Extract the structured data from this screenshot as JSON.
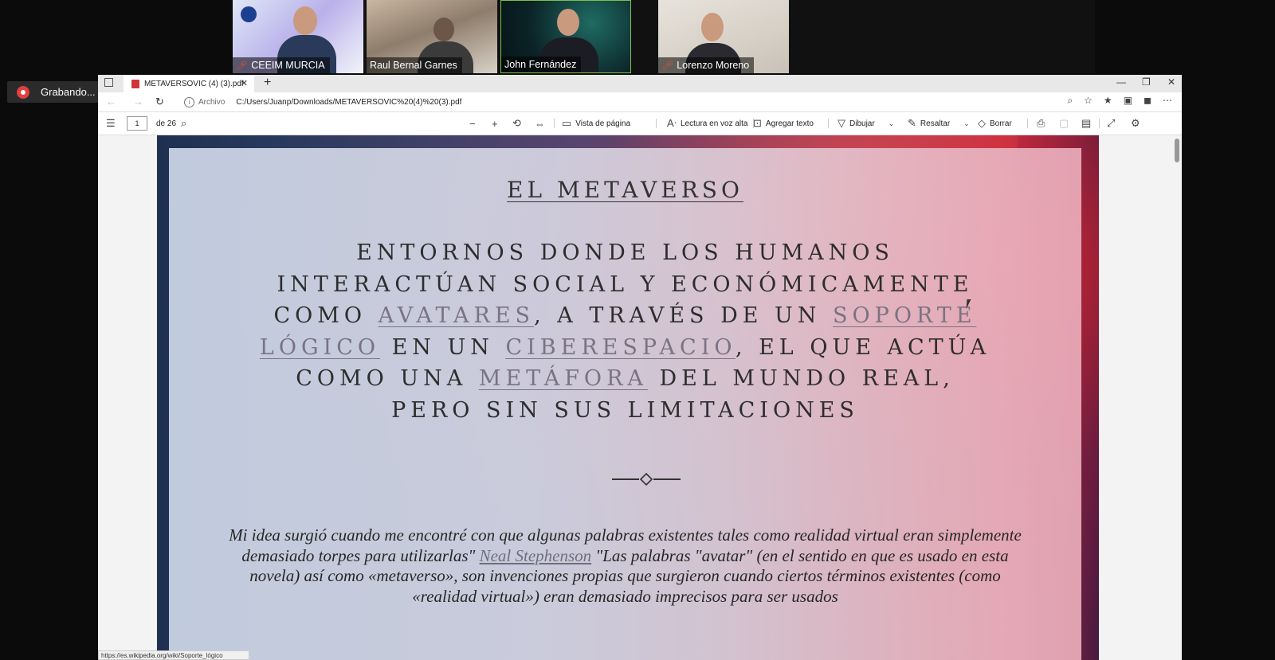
{
  "meeting": {
    "participants": [
      {
        "name": "CEEIM MURCIA",
        "muted": true
      },
      {
        "name": "Raul Bernal Garnes",
        "muted": false
      },
      {
        "name": "John Fernández",
        "muted": false
      },
      {
        "name": "Lorenzo Moreno",
        "muted": true
      }
    ],
    "recording_label": "Grabando..."
  },
  "browser": {
    "tab_title": "METAVERSOVIC (4) (3).pdf",
    "address_scheme_label": "Archivo",
    "url": "C:/Users/Juanp/Downloads/METAVERSOVIC%20(4)%20(3).pdf",
    "status_url": "https://es.wikipedia.org/wiki/Soporte_lógico"
  },
  "pdf_toolbar": {
    "page_current": "1",
    "page_total_label": "de 26",
    "page_view": "Vista de página",
    "read_aloud": "Lectura en voz alta",
    "add_text": "Agregar texto",
    "draw": "Dibujar",
    "highlight": "Resaltar",
    "erase": "Borrar"
  },
  "slide": {
    "title": "EL METAVERSO",
    "def": {
      "p1": "Entornos donde los humanos interactúan social y económicamente como ",
      "l1": "avatares",
      "p2": ", a través de un ",
      "l2": "soporte lógico",
      "p3": " en un ",
      "l3": "ciberespacio",
      "p4": ", el que actúa como una ",
      "l4": "metáfora",
      "p5": " del mundo real, pero sin sus limitaciones"
    },
    "quote": {
      "q1": "Mi idea surgió cuando me encontré con que algunas palabras existentes tales como realidad virtual eran simplemente demasiado torpes para utilizarlas\" ",
      "author": "Neal Stephenson",
      "q2": "  \"Las palabras \"avatar\" (en el sentido en que es usado en esta novela) así como «metaverso», son invenciones propias que surgieron cuando ciertos términos existentes (como «realidad virtual») eran demasiado imprecisos para ser usados"
    }
  }
}
